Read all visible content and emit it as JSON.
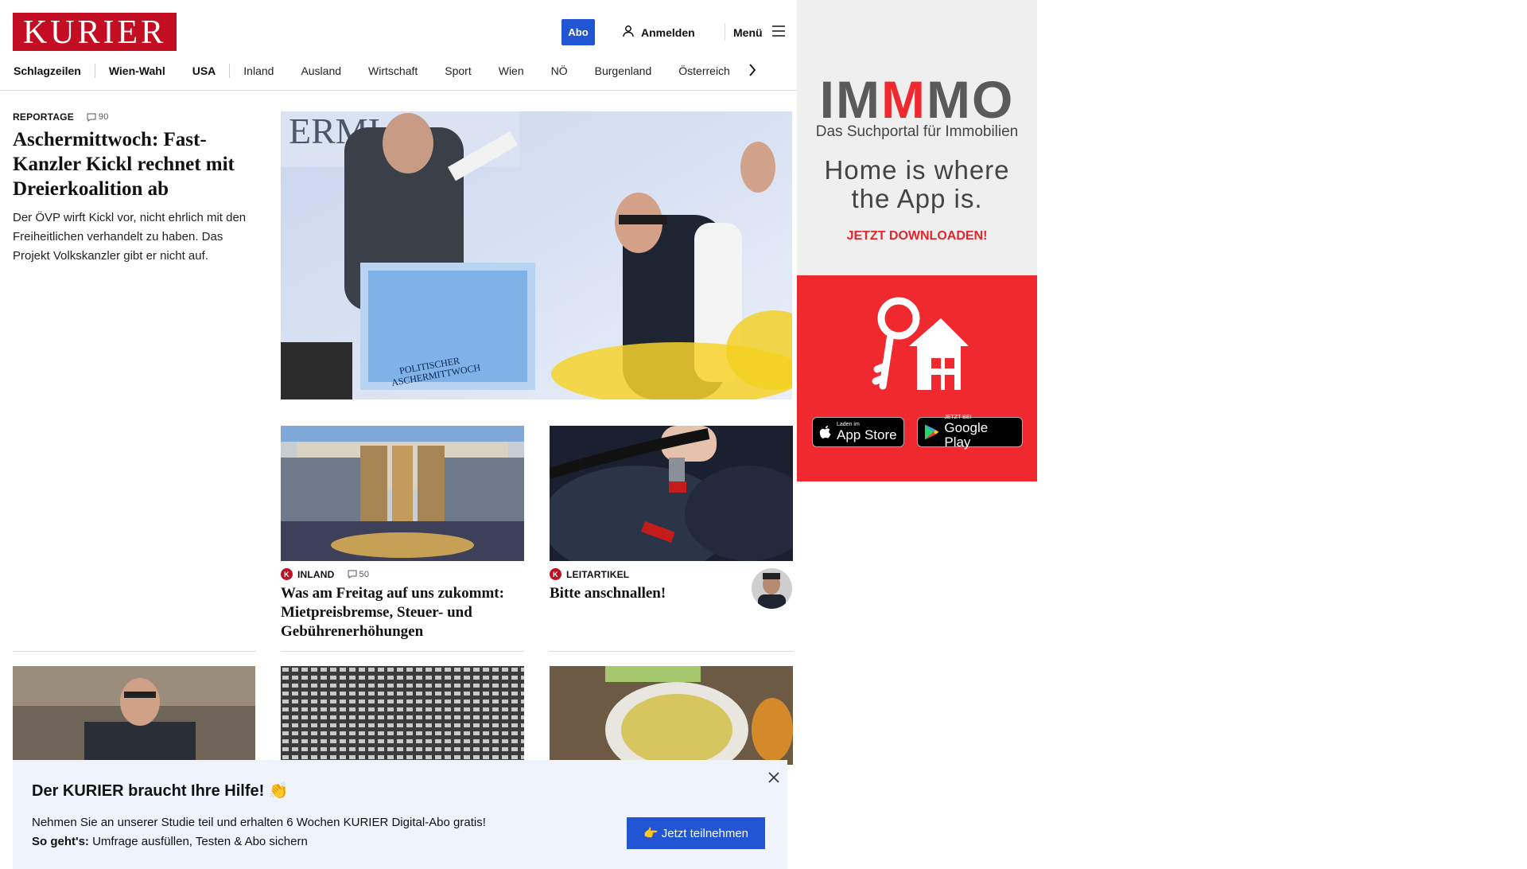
{
  "header": {
    "logo": "KURIER",
    "abo_label": "Abo",
    "login_label": "Anmelden",
    "menu_label": "Menü"
  },
  "nav": {
    "items": [
      "Schlagzeilen",
      "Wien-Wahl",
      "USA",
      "Inland",
      "Ausland",
      "Wirtschaft",
      "Sport",
      "Wien",
      "NÖ",
      "Burgenland",
      "Österreich"
    ]
  },
  "lead": {
    "kicker": "REPORTAGE",
    "comments": "90",
    "title": "Aschermittwoch: Fast-Kanzler Kickl rechnet mit Dreierkoalition ab",
    "text": "Der ÖVP wirft Kickl vor, nicht ehrlich mit den Freiheitlichen verhandelt zu haben. Das Projekt Volkskanzler gibt er nicht auf.",
    "image_text": [
      "POLITISCHER",
      "ASCHERMITTWOCH"
    ]
  },
  "cards": [
    {
      "kicker": "INLAND",
      "comments": "50",
      "title": "Was am Freitag auf uns zukommt: Mietpreisbremse, Steuer- und Gebührenerhöhungen"
    },
    {
      "kicker": "LEITARTIKEL",
      "title": "Bitte anschnallen!"
    }
  ],
  "ad": {
    "brand_prefix": "IM",
    "brand_accent": "M",
    "brand_suffix": "MO",
    "tagline": "Das Suchportal für Immobilien",
    "slogan_line1": "Home is where",
    "slogan_line2": "the App is.",
    "cta": "JETZT DOWNLOADEN!",
    "appstore_small": "Laden im",
    "appstore_large": "App Store",
    "googleplay_small": "JETZT BEI",
    "googleplay_large": "Google Play"
  },
  "survey": {
    "title": "Der KURIER braucht Ihre Hilfe! 👏",
    "text": "Nehmen Sie an unserer Studie teil und erhalten 6 Wochen KURIER Digital-Abo gratis!",
    "howto_bold": "So geht's:",
    "howto_text": "Umfrage ausfüllen, Testen & Abo sichern",
    "button": "👉 Jetzt teilnehmen"
  },
  "colors": {
    "brand_red": "#c30d23",
    "accent_blue": "#2155d4",
    "ad_red": "#f0292f",
    "overlay_bg": "#eef3fc"
  }
}
